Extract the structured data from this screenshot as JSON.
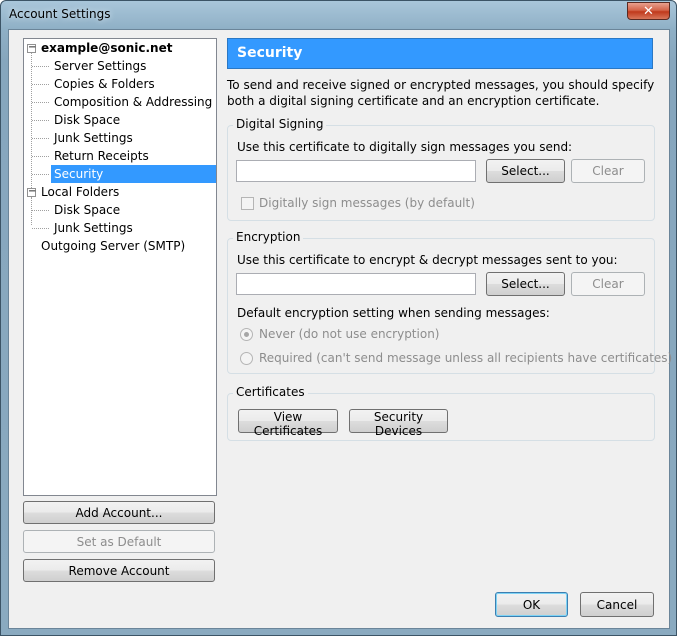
{
  "window": {
    "title": "Account Settings",
    "close_glyph": "✕"
  },
  "tree": {
    "items": [
      {
        "label": "example@sonic.net",
        "bold": true
      },
      {
        "label": "Server Settings"
      },
      {
        "label": "Copies & Folders"
      },
      {
        "label": "Composition & Addressing"
      },
      {
        "label": "Disk Space"
      },
      {
        "label": "Junk Settings"
      },
      {
        "label": "Return Receipts"
      },
      {
        "label": "Security",
        "selected": true
      },
      {
        "label": "Local Folders"
      },
      {
        "label": "Disk Space"
      },
      {
        "label": "Junk Settings"
      },
      {
        "label": "Outgoing Server (SMTP)"
      }
    ],
    "expander_glyph": "−"
  },
  "account_buttons": {
    "add_account": "Add Account...",
    "set_default": "Set as Default",
    "remove_account": "Remove Account"
  },
  "security": {
    "header": "Security",
    "description": "To send and receive signed or encrypted messages, you should specify both a digital signing certificate and an encryption certificate.",
    "digital_signing": {
      "legend": "Digital Signing",
      "prompt": "Use this certificate to digitally sign messages you send:",
      "certificate_value": "",
      "select_button": "Select...",
      "clear_button": "Clear",
      "sign_checkbox": "Digitally sign messages (by default)",
      "sign_checked": false
    },
    "encryption": {
      "legend": "Encryption",
      "prompt": "Use this certificate to encrypt & decrypt messages sent to you:",
      "certificate_value": "",
      "select_button": "Select...",
      "clear_button": "Clear",
      "default_setting_label": "Default encryption setting when sending messages:",
      "option_never": "Never (do not use encryption)",
      "option_required": "Required (can't send message unless all recipients have certificates)",
      "selected_option": "never"
    },
    "certificates": {
      "legend": "Certificates",
      "view_button": "View Certificates",
      "devices_button": "Security Devices"
    }
  },
  "dialog_buttons": {
    "ok": "OK",
    "cancel": "Cancel"
  },
  "colors": {
    "accent": "#3399ff",
    "close": "#c0391c"
  }
}
